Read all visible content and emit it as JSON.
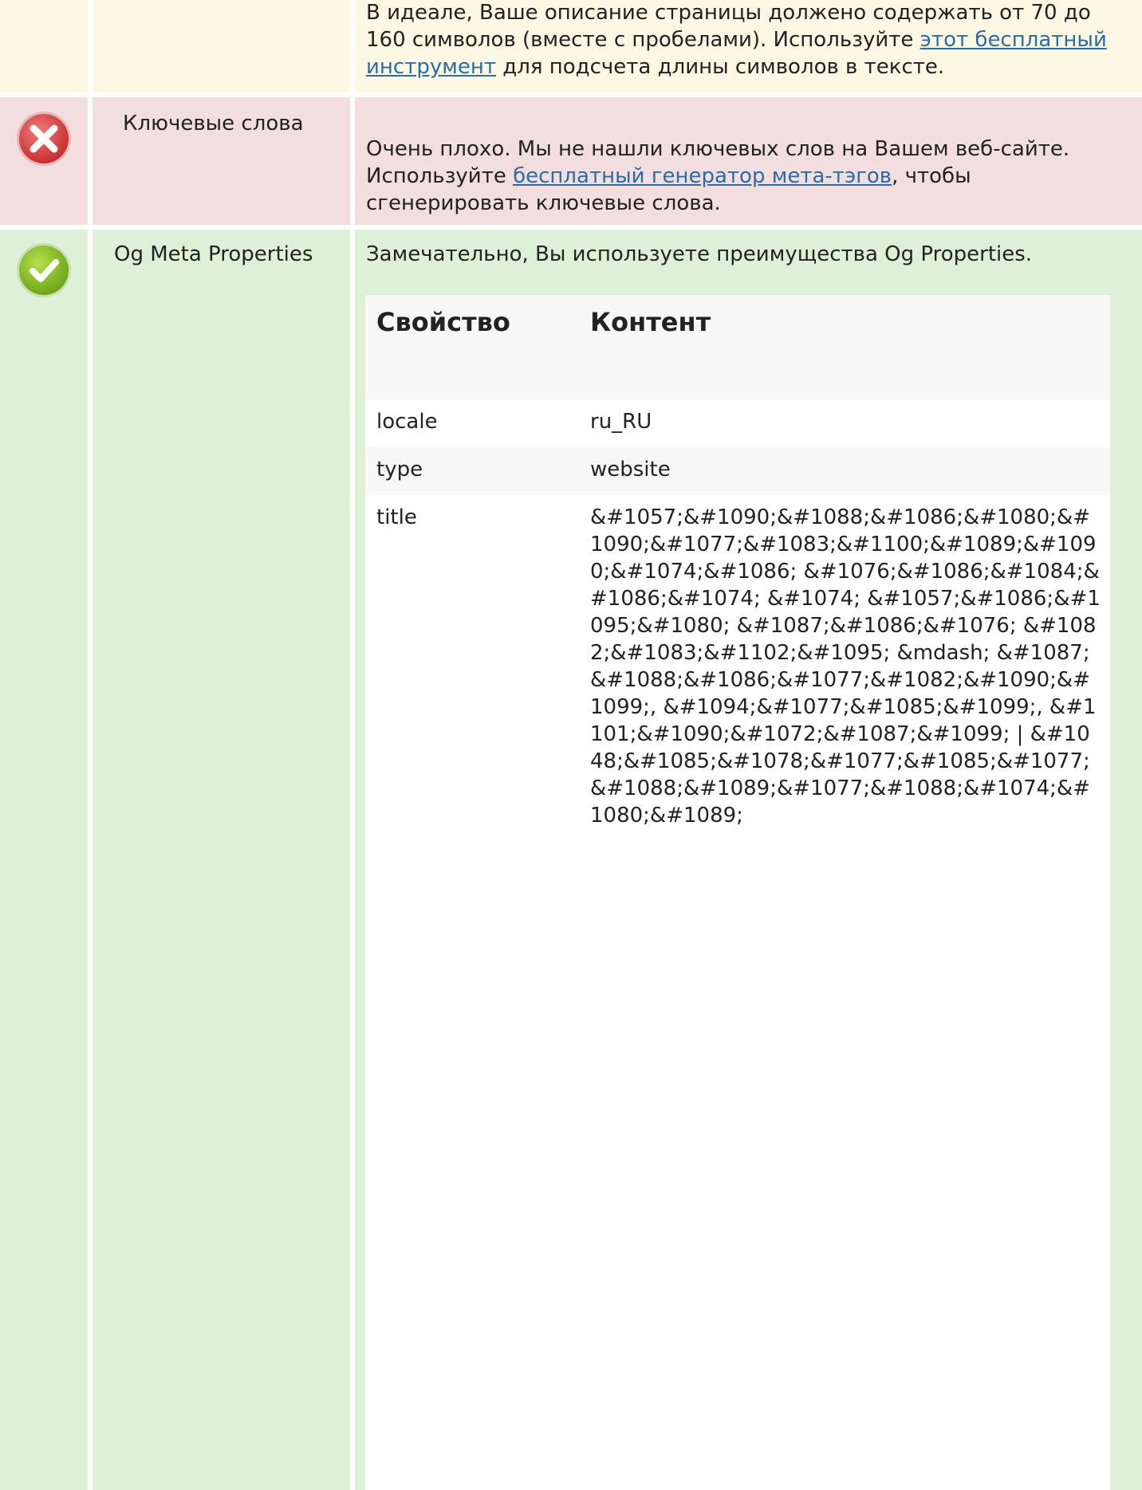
{
  "description_row": {
    "text_before": "В идеале, Ваше описание страницы должено содержать от 70 до 160 символов (вместе с пробелами). Используйте ",
    "link": "этот бесплатный инструмент",
    "text_after": " для подсчета длины символов в тексте."
  },
  "keywords_row": {
    "name": "Ключевые слова",
    "status": "error",
    "text_before": "Очень плохо. Мы не нашли ключевых слов на Вашем веб-сайте. Используйте ",
    "link": "бесплатный генератор мета-тэгов",
    "text_after": ", чтобы сгенерировать ключевые слова."
  },
  "og_row": {
    "name": "Og Meta Properties",
    "status": "ok",
    "message": "Замечательно, Вы используете преимущества Og Properties.",
    "table": {
      "headers": [
        "Свойство",
        "Контент"
      ],
      "rows": [
        {
          "property": "locale",
          "content": "ru_RU"
        },
        {
          "property": "type",
          "content": "website"
        },
        {
          "property": "title",
          "content": "&#1057;&#1090;&#1088;&#1086;&#1080;&#1090;&#1077;&#1083;&#1100;&#1089;&#1090;&#1074;&#1086; &#1076;&#1086;&#1084;&#1086;&#1074; &#1074; &#1057;&#1086;&#1095;&#1080; &#1087;&#1086;&#1076; &#1082;&#1083;&#1102;&#1095; &mdash; &#1087;&#1088;&#1086;&#1077;&#1082;&#1090;&#1099;, &#1094;&#1077;&#1085;&#1099;, &#1101;&#1090;&#1072;&#1087;&#1099; | &#1048;&#1085;&#1078;&#1077;&#1085;&#1077;&#1088;&#1089;&#1077;&#1088;&#1074;&#1080;&#1089;"
        }
      ]
    }
  },
  "colors": {
    "warning_bg": "#fcf8e3",
    "error_bg": "#f2dede",
    "success_bg": "#dff0d8",
    "link": "#2d6ca2"
  }
}
